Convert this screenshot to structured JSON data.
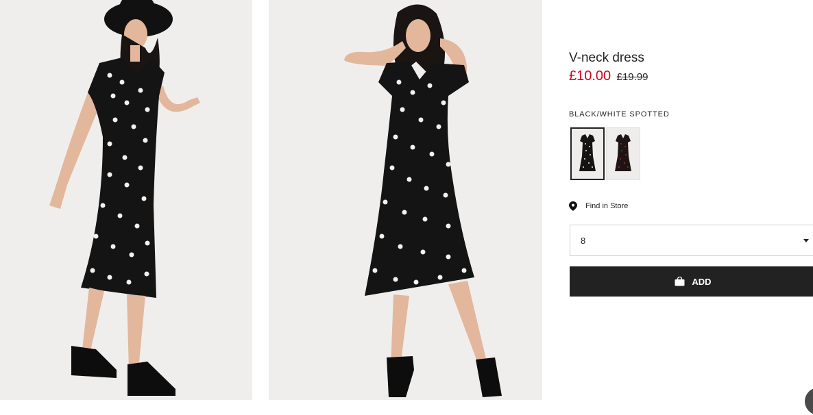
{
  "product": {
    "name": "V-neck dress",
    "price_sale": "£10.00",
    "price_original": "£19.99",
    "color_name": "BLACK/WHITE SPOTTED"
  },
  "store": {
    "label": "Find in Store"
  },
  "size_select": {
    "value": "8"
  },
  "add_button": {
    "label": "ADD"
  },
  "icons": {
    "pin": "map-pin-icon",
    "bag": "shopping-bag-icon",
    "chevron": "chevron-down-icon"
  },
  "colors": {
    "sale_red": "#d6001c",
    "text": "#222222",
    "button_bg": "#222222",
    "photo_bg": "#efeeed"
  }
}
